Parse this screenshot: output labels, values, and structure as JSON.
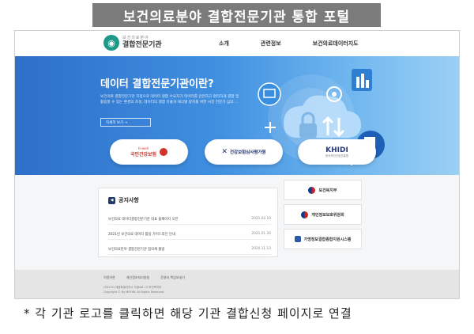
{
  "caption": "보건의료분야 결합전문기관 통합 포털",
  "header": {
    "logo_sub": "보건의료분야",
    "logo_main": "결합전문기관",
    "nav": [
      "소개",
      "관련정보",
      "보건의료데이터지도"
    ]
  },
  "hero": {
    "title": "데이터 결합전문기관이란?",
    "description": "보건의료 결합전문기관 지정으로 데이터 결합 수요자가 데이터를 안전하고 편리하게 결합 및 활용할 수 있는 환경의 조성, 데이터의 결합 유출과 재식별 방지를 위한 사전 전문가 심의 ...",
    "button": "자세히 보기 →"
  },
  "org_logos": {
    "nhis_en": "hi-well",
    "nhis": "국민건강보험",
    "hira": "건강보험심사평가원",
    "khidi": "KHIDI",
    "khidi_sub": "한국보건산업진흥원"
  },
  "notice": {
    "title": "공지사항",
    "rows": [
      {
        "title": "보건의료 데이터결합전문기관 대표 홈페이지 오픈",
        "date": "2021.02.10"
      },
      {
        "title": "2021년 보건의료 데이터 활용 가이드라인 안내",
        "date": "2021.01.26"
      },
      {
        "title": "보건의료분야 결합전문기관 협의체 출범",
        "date": "2020.11.13"
      }
    ]
  },
  "agencies": [
    "보건복지부",
    "개인정보보호위원회",
    "가명정보결합종합지원시스템"
  ],
  "footer": {
    "links": [
      "이용약관",
      "개인정보처리방침",
      "운영자 책임보내기"
    ],
    "address": "(30113) 세종특별자치시 도움4로 13 보건복지부",
    "copyright": "Copyright © By MOHW. All Rights Reserved."
  },
  "bottom_note": "* 각 기관 로고를 클릭하면 해당 기관 결합신청 페이지로 연결"
}
